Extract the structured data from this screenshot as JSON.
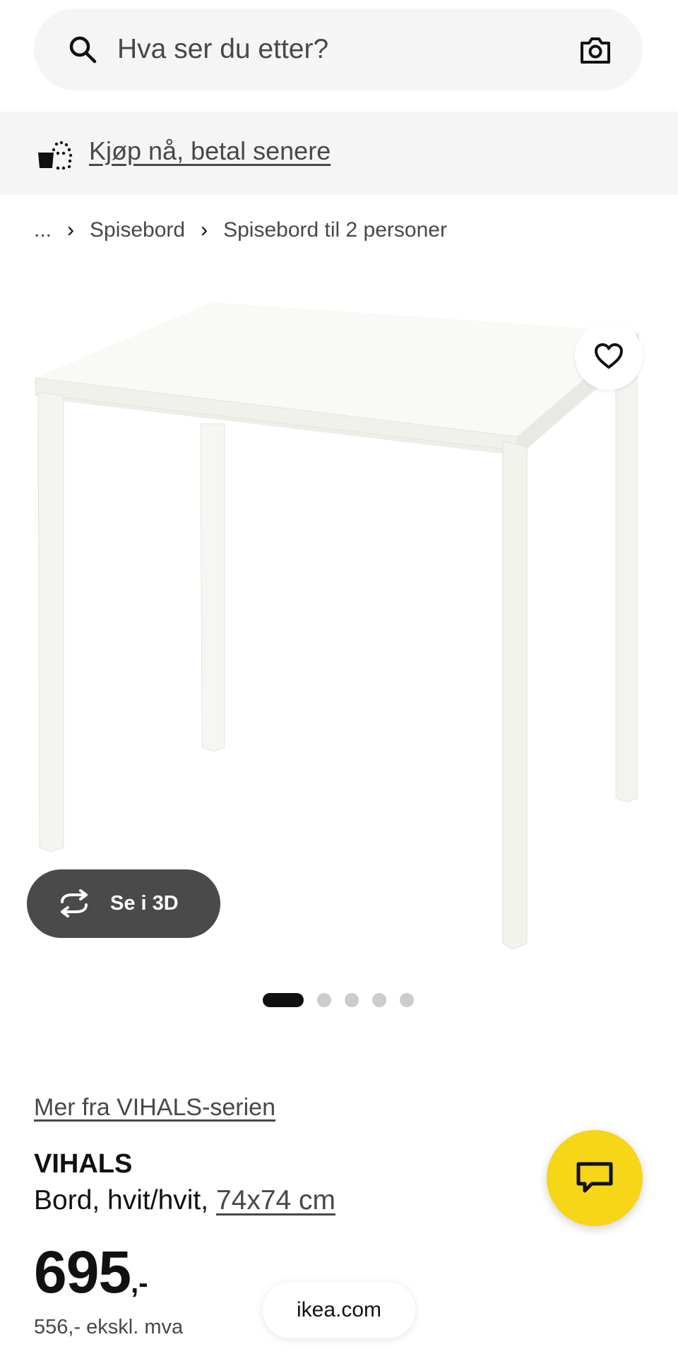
{
  "search": {
    "placeholder": "Hva ser du etter?",
    "left_icon": "search-icon",
    "right_icon": "camera-icon"
  },
  "promo": {
    "icon": "shopping-bag-icon",
    "link_text": "Kjøp nå, betal senere"
  },
  "breadcrumb": {
    "items": [
      "...",
      "Spisebord",
      "Spisebord til 2 personer"
    ],
    "separator_icon": "chevron-right-icon"
  },
  "gallery": {
    "favorite_icon": "heart-icon",
    "view3d_icon": "rotate-icon",
    "view3d_label": "Se i 3D",
    "image_count": 5,
    "active_index": 0
  },
  "product": {
    "series_link": "Mer fra VIHALS-serien",
    "name": "VIHALS",
    "description_prefix": "Bord, hvit/hvit, ",
    "size_link": "74x74 cm",
    "price_amount": "695",
    "price_suffix": ",-",
    "price_ex_vat": "556,- ekskl. mva"
  },
  "chat": {
    "icon": "chat-icon"
  },
  "browser": {
    "domain": "ikea.com"
  },
  "colors": {
    "accent_yellow": "#f7d517",
    "text_dark": "#111111",
    "text_grey": "#484848",
    "surface_grey": "#f5f5f5",
    "pill_dark": "#4a4a4a"
  }
}
